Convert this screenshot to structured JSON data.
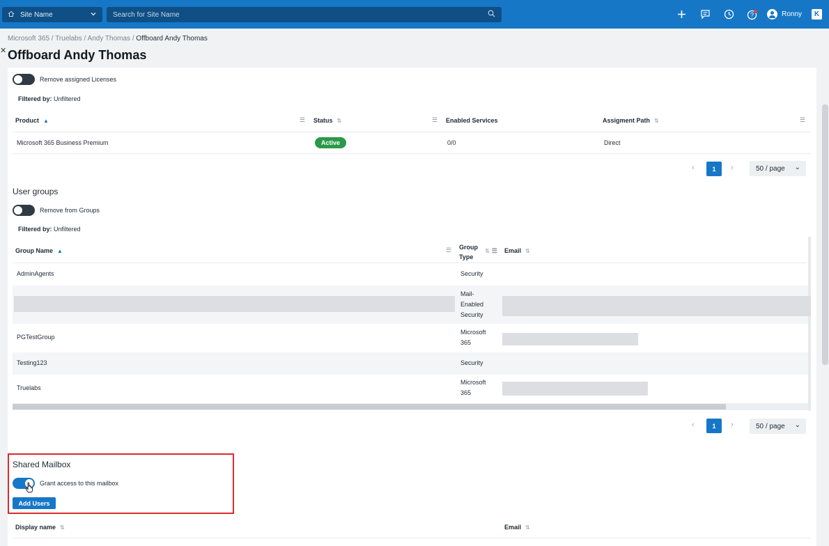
{
  "topbar": {
    "site_select_label": "Site Name",
    "search_placeholder": "Search for Site Name",
    "user_name": "Ronny",
    "brand_letter": "K"
  },
  "breadcrumb": {
    "items": [
      "Microsoft 365",
      "Truelabs",
      "Andy Thomas"
    ],
    "separator": " / ",
    "current": "Offboard Andy Thomas"
  },
  "page_title": "Offboard Andy Thomas",
  "licenses": {
    "toggle_label": "Remove assigned Licenses",
    "filtered_label": "Filtered by:",
    "filtered_value": "Unfiltered",
    "columns": [
      "Product",
      "Status",
      "Enabled Services",
      "Assigment Path"
    ],
    "rows": [
      {
        "product": "Microsoft 365 Business Premium",
        "status": "Active",
        "enabled_services": "0/0",
        "assignment_path": "Direct"
      }
    ],
    "page": "1",
    "page_size": "50 / page"
  },
  "groups": {
    "title": "User groups",
    "toggle_label": "Remove from Groups",
    "filtered_label": "Filtered by:",
    "filtered_value": "Unfiltered",
    "columns": [
      "Group Name",
      "Group Type",
      "Email"
    ],
    "group_type_header_lines": [
      "Group",
      "Type"
    ],
    "rows": [
      {
        "name": "AdminAgents",
        "type_lines": [
          "Security"
        ]
      },
      {
        "name": "",
        "type_lines": [
          "Mail-",
          "Enabled",
          "Security"
        ]
      },
      {
        "name": "PGTestGroup",
        "type_lines": [
          "Microsoft",
          "365"
        ]
      },
      {
        "name": "Testing123",
        "type_lines": [
          "Security"
        ]
      },
      {
        "name": "Truelabs",
        "type_lines": [
          "Microsoft",
          "365"
        ]
      }
    ],
    "page": "1",
    "page_size": "50 / page"
  },
  "shared_mailbox": {
    "title": "Shared Mailbox",
    "toggle_label": "Grant access to this mailbox",
    "toggle_on": true,
    "add_users_label": "Add Users",
    "columns": [
      "Display name",
      "Email"
    ]
  },
  "colors": {
    "primary": "#1777c7",
    "active_badge": "#2a9a4a",
    "highlight_border": "#d92b2b"
  }
}
